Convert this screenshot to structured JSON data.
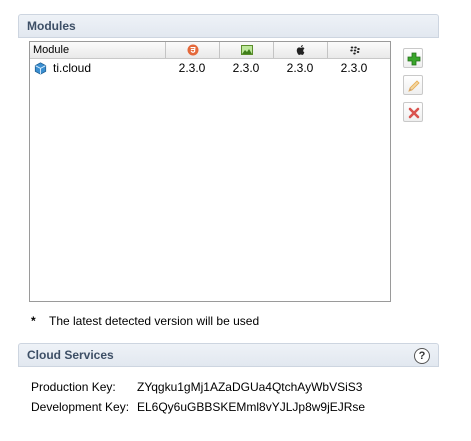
{
  "modules_section": {
    "title": "Modules",
    "table": {
      "column_module": "Module",
      "platform_icons": [
        "html5-icon",
        "mobileweb-image-icon",
        "apple-icon",
        "blackberry-icon"
      ],
      "rows": [
        {
          "icon": "cube-module-icon",
          "name": "ti.cloud",
          "versions": [
            "2.3.0",
            "2.3.0",
            "2.3.0",
            "2.3.0"
          ]
        }
      ]
    },
    "buttons": [
      "add-icon",
      "edit-pencil-icon",
      "remove-x-icon"
    ],
    "note_marker": "*",
    "note_text": "The latest detected version will be used"
  },
  "cloud_section": {
    "title": "Cloud Services",
    "help_label": "?",
    "production_key_label": "Production Key:",
    "production_key_value": "ZYqgku1gMj1AZaDGUa4QtchAyWbVSiS3",
    "development_key_label": "Development Key:",
    "development_key_value": "EL6Qy6uGBBSKEMml8vYJLJp8w9jEJRse"
  },
  "colors": {
    "section_title": "#3d4f66",
    "add_green": "#3aa62c",
    "remove_red": "#d9534f",
    "pencil_orange": "#e8b05a"
  }
}
